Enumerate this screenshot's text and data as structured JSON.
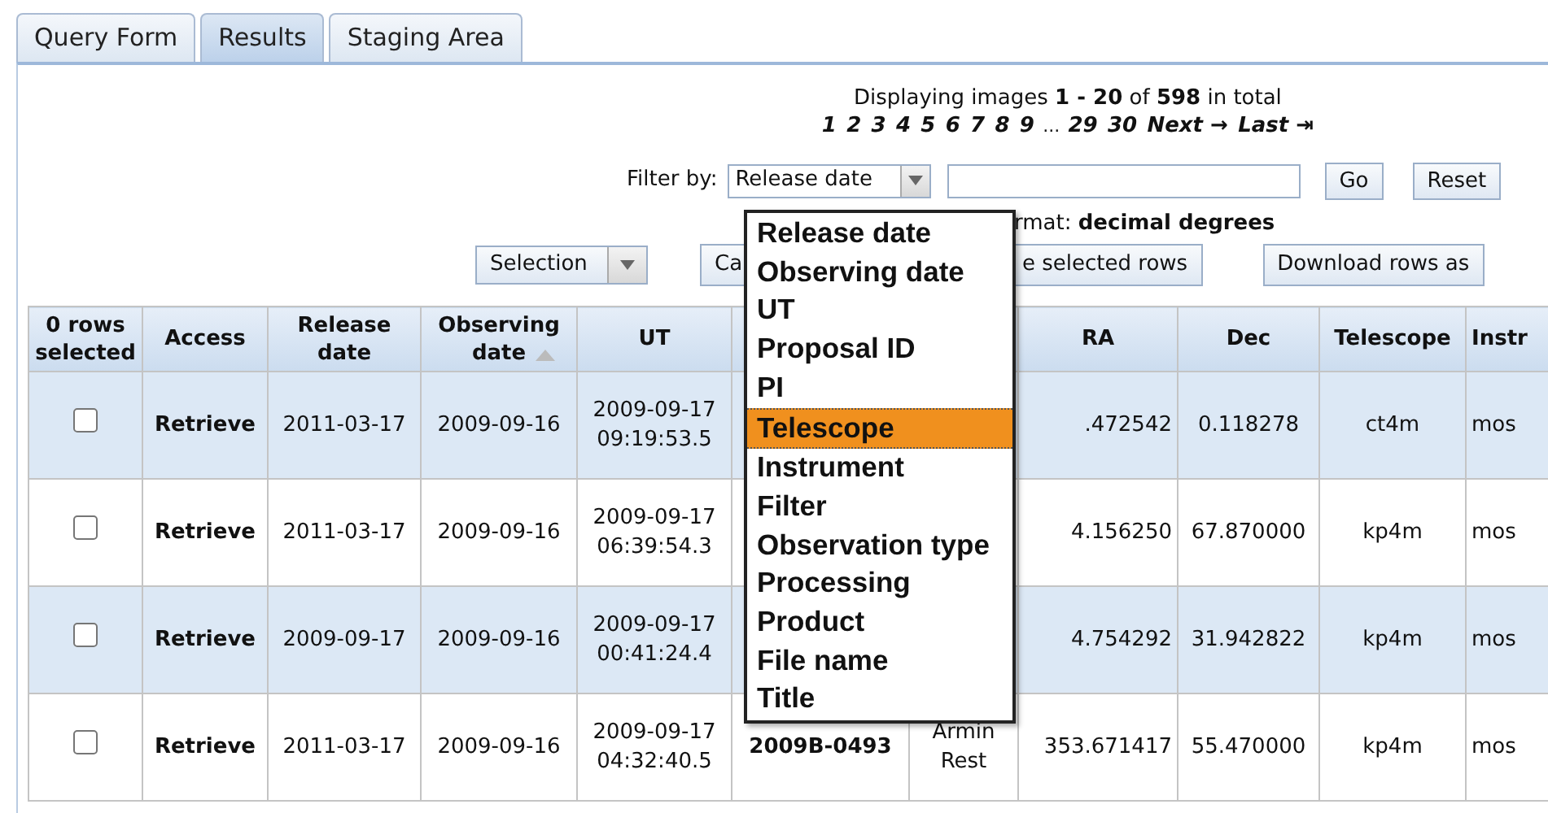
{
  "tabs": [
    {
      "label": "Query Form",
      "selected": false
    },
    {
      "label": "Results",
      "selected": true
    },
    {
      "label": "Staging Area",
      "selected": false
    }
  ],
  "summary": "Displaying images **1 - 20** of **598** in total",
  "pagination": [
    {
      "kind": "page",
      "label": "1"
    },
    {
      "kind": "page",
      "label": "2"
    },
    {
      "kind": "page",
      "label": "3"
    },
    {
      "kind": "page",
      "label": "4"
    },
    {
      "kind": "page",
      "label": "5"
    },
    {
      "kind": "page",
      "label": "6"
    },
    {
      "kind": "page",
      "label": "7"
    },
    {
      "kind": "page",
      "label": "8"
    },
    {
      "kind": "page",
      "label": "9"
    },
    {
      "kind": "gap",
      "label": "..."
    },
    {
      "kind": "page",
      "label": "29"
    },
    {
      "kind": "page",
      "label": "30"
    },
    {
      "kind": "nav",
      "label": "Next →"
    },
    {
      "kind": "nav",
      "label": "Last ⇥"
    }
  ],
  "filter": {
    "label": "Filter by:",
    "value": "Release date",
    "go": "Go",
    "reset": "Reset"
  },
  "format_note": "rmat: **decimal degrees**",
  "toolbar": {
    "selection": "Selection",
    "cart_fragment": "Ca",
    "selected_rows_fragment": "e selected rows",
    "download": "Download rows as"
  },
  "dropdown": [
    {
      "label": "Release date",
      "selected": false
    },
    {
      "label": "Observing date",
      "selected": false
    },
    {
      "label": "UT",
      "selected": false
    },
    {
      "label": "Proposal ID",
      "selected": false
    },
    {
      "label": "PI",
      "selected": false
    },
    {
      "label": "Telescope",
      "selected": true
    },
    {
      "label": "Instrument",
      "selected": false
    },
    {
      "label": "Filter",
      "selected": false
    },
    {
      "label": "Observation type",
      "selected": false
    },
    {
      "label": "Processing",
      "selected": false
    },
    {
      "label": "Product",
      "selected": false
    },
    {
      "label": "File name",
      "selected": false
    },
    {
      "label": "Title",
      "selected": false
    }
  ],
  "table": {
    "columns": [
      {
        "label": "0 rows selected"
      },
      {
        "label": "Access"
      },
      {
        "label": "Release date"
      },
      {
        "label": "Observing date",
        "sorted": true
      },
      {
        "label": "UT"
      },
      {},
      {},
      {
        "label": "RA"
      },
      {
        "label": "Dec"
      },
      {
        "label": "Telescope"
      },
      {
        "label": "Instr"
      }
    ],
    "rows": [
      {
        "checked": false,
        "cells": [
          "",
          "Retrieve",
          "2011-03-17",
          "2009-09-16",
          "2009-09-17 09:19:53.5",
          "",
          "",
          ".472542",
          "0.118278",
          "ct4m",
          "mos"
        ]
      },
      {
        "checked": false,
        "cells": [
          "",
          "Retrieve",
          "2011-03-17",
          "2009-09-16",
          "2009-09-17 06:39:54.3",
          "",
          "",
          "4.156250",
          "67.870000",
          "kp4m",
          "mos"
        ]
      },
      {
        "checked": false,
        "cells": [
          "",
          "Retrieve",
          "2009-09-17",
          "2009-09-16",
          "2009-09-17 00:41:24.4",
          "",
          "",
          "4.754292",
          "31.942822",
          "kp4m",
          "mos"
        ]
      },
      {
        "checked": false,
        "cells": [
          "",
          "Retrieve",
          "2011-03-17",
          "2009-09-16",
          "2009-09-17 04:32:40.5",
          "2009B-0493",
          "Armin Rest",
          "353.671417",
          "55.470000",
          "kp4m",
          "mos"
        ]
      }
    ]
  }
}
